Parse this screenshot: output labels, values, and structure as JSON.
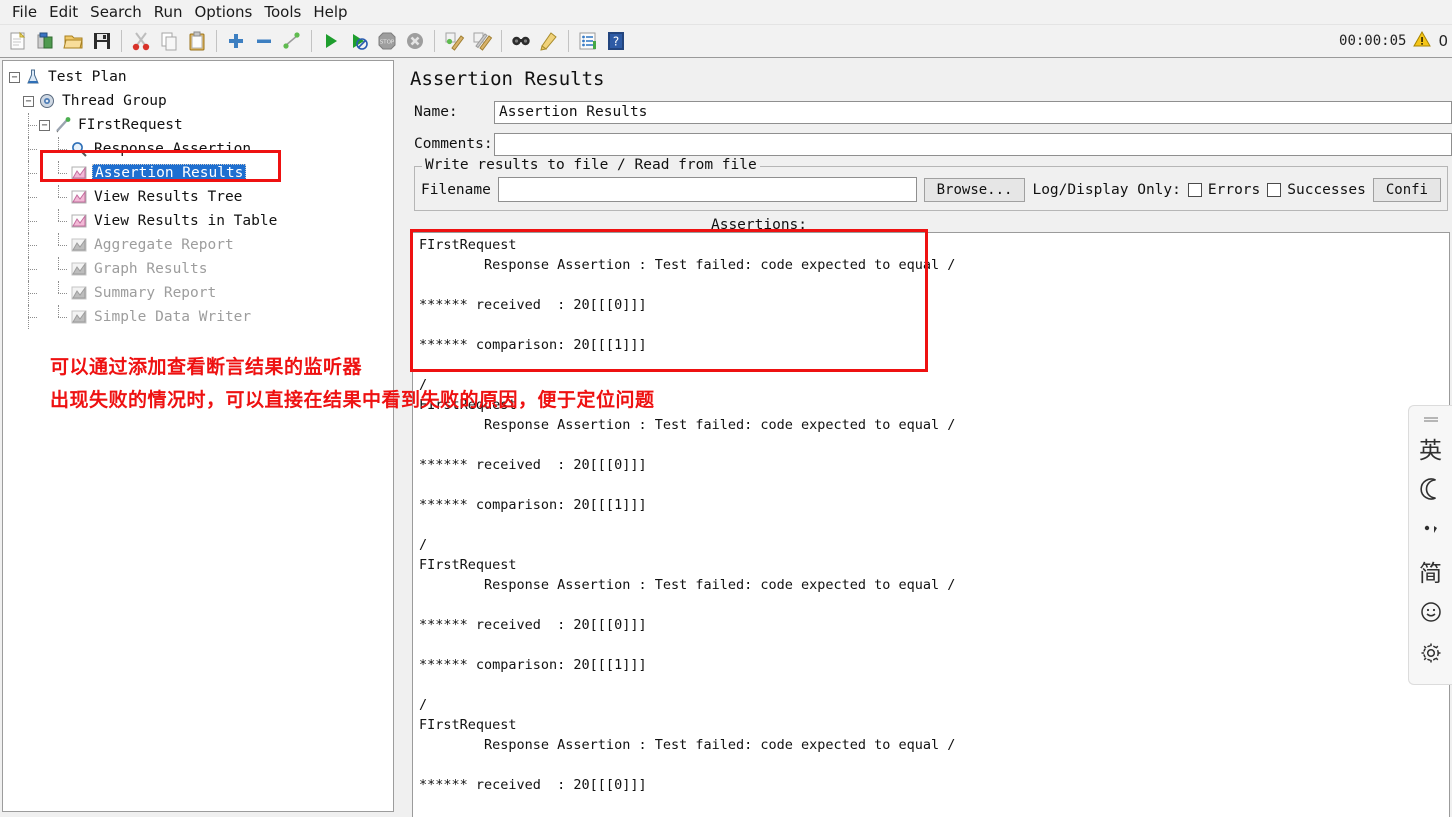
{
  "menubar": {
    "items": [
      {
        "label": "File"
      },
      {
        "label": "Edit"
      },
      {
        "label": "Search"
      },
      {
        "label": "Run"
      },
      {
        "label": "Options"
      },
      {
        "label": "Tools"
      },
      {
        "label": "Help"
      }
    ]
  },
  "toolbar": {
    "buttons": [
      {
        "name": "new-test-plan-icon",
        "title": "New"
      },
      {
        "name": "templates-icon",
        "title": "Templates"
      },
      {
        "name": "open-icon",
        "title": "Open"
      },
      {
        "name": "save-icon",
        "title": "Save Test Plan"
      },
      {
        "name": "cut-icon",
        "title": "Cut"
      },
      {
        "name": "copy-icon",
        "title": "Copy"
      },
      {
        "name": "paste-icon",
        "title": "Paste"
      },
      {
        "name": "expand-all-icon",
        "title": "Expand All"
      },
      {
        "name": "collapse-all-icon",
        "title": "Collapse All"
      },
      {
        "name": "toggle-icon",
        "title": "Toggle"
      },
      {
        "name": "start-icon",
        "title": "Start"
      },
      {
        "name": "start-no-timers-icon",
        "title": "Start no pauses"
      },
      {
        "name": "stop-icon",
        "title": "Stop"
      },
      {
        "name": "shutdown-icon",
        "title": "Shutdown"
      },
      {
        "name": "clear-icon",
        "title": "Clear"
      },
      {
        "name": "clear-all-icon",
        "title": "Clear All"
      },
      {
        "name": "search-icon",
        "title": "Search"
      },
      {
        "name": "reset-search-icon",
        "title": "Reset Search"
      },
      {
        "name": "function-helper-icon",
        "title": "Function Helper Dialog"
      },
      {
        "name": "help-icon",
        "title": "Help"
      }
    ],
    "timer": "00:00:05",
    "warning_count": "0"
  },
  "tree": {
    "nodes": [
      {
        "label": "Test Plan",
        "depth": 0,
        "icon": "test-plan-icon",
        "twisty": "-",
        "disabled": false,
        "selected": false
      },
      {
        "label": "Thread Group",
        "depth": 1,
        "icon": "thread-group-icon",
        "twisty": "-",
        "disabled": false,
        "selected": false
      },
      {
        "label": "FIrstRequest",
        "depth": 2,
        "icon": "http-sampler-icon",
        "twisty": "-",
        "disabled": false,
        "selected": false
      },
      {
        "label": "Response Assertion",
        "depth": 3,
        "icon": "assertion-icon",
        "twisty": "",
        "disabled": false,
        "selected": false
      },
      {
        "label": "Assertion Results",
        "depth": 3,
        "icon": "listener-icon",
        "twisty": "",
        "disabled": false,
        "selected": true
      },
      {
        "label": "View Results Tree",
        "depth": 3,
        "icon": "listener-icon",
        "twisty": "",
        "disabled": false,
        "selected": false
      },
      {
        "label": "View Results in Table",
        "depth": 3,
        "icon": "listener-icon",
        "twisty": "",
        "disabled": false,
        "selected": false
      },
      {
        "label": "Aggregate Report",
        "depth": 3,
        "icon": "listener-icon-disabled",
        "twisty": "",
        "disabled": true,
        "selected": false
      },
      {
        "label": "Graph Results",
        "depth": 3,
        "icon": "listener-icon-disabled",
        "twisty": "",
        "disabled": true,
        "selected": false
      },
      {
        "label": "Summary Report",
        "depth": 3,
        "icon": "listener-icon-disabled",
        "twisty": "",
        "disabled": true,
        "selected": false
      },
      {
        "label": "Simple Data Writer",
        "depth": 3,
        "icon": "listener-icon-disabled",
        "twisty": "",
        "disabled": true,
        "selected": false
      }
    ]
  },
  "panel": {
    "title": "Assertion Results",
    "name_label": "Name:",
    "name_value": "Assertion Results",
    "comments_label": "Comments:",
    "comments_value": "",
    "comments_placeholder": "",
    "fieldset_legend": "Write results to file / Read from file",
    "filename_label": "Filename",
    "filename_value": "",
    "filename_placeholder": "",
    "browse_label": "Browse...",
    "log_display_label": "Log/Display Only:",
    "errors_label": "Errors",
    "errors_checked": false,
    "successes_label": "Successes",
    "successes_checked": false,
    "configure_label": "Confi",
    "assertions_label": "Assertions:",
    "results_lines": [
      "FIrstRequest",
      "        Response Assertion : Test failed: code expected to equal /",
      "",
      "****** received  : 20[[[0]]]",
      "",
      "****** comparison: 20[[[1]]]",
      "",
      "/",
      "FIrstRequest",
      "        Response Assertion : Test failed: code expected to equal /",
      "",
      "****** received  : 20[[[0]]]",
      "",
      "****** comparison: 20[[[1]]]",
      "",
      "/",
      "FIrstRequest",
      "        Response Assertion : Test failed: code expected to equal /",
      "",
      "****** received  : 20[[[0]]]",
      "",
      "****** comparison: 20[[[1]]]",
      "",
      "/",
      "FIrstRequest",
      "        Response Assertion : Test failed: code expected to equal /",
      "",
      "****** received  : 20[[[0]]]"
    ]
  },
  "annotations": {
    "color": "#ee1111",
    "line1": "可以通过添加查看断言结果的监听器",
    "line2": "出现失败的情况时，可以直接在结果中看到失败的原因，便于定位问题"
  },
  "ime": {
    "items": [
      {
        "name": "ime-drag-handle",
        "glyph": "="
      },
      {
        "name": "ime-language-english-icon",
        "glyph": "英"
      },
      {
        "name": "ime-moon-icon",
        "glyph": "☽"
      },
      {
        "name": "ime-punctuation-icon",
        "glyph": "•,"
      },
      {
        "name": "ime-simplified-chinese-icon",
        "glyph": "简"
      },
      {
        "name": "ime-emoji-icon",
        "glyph": "☺"
      },
      {
        "name": "ime-settings-gear-icon",
        "glyph": "⚙"
      }
    ]
  }
}
